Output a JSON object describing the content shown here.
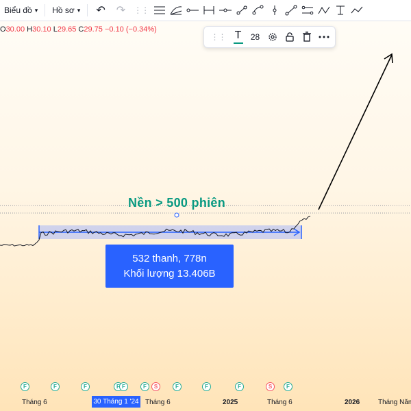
{
  "toolbar": {
    "chart_menu": "Biểu đồ",
    "profile_menu": "Hồ sơ",
    "undo": "↶",
    "redo": "↷",
    "tools": [
      "horizontal-lines-icon",
      "fib-fan-icon",
      "horizontal-ray-icon",
      "date-range-icon",
      "cross-line-icon",
      "trend-line-icon",
      "curve-icon",
      "vertical-line-icon",
      "trend-angle-icon",
      "parallel-channel-icon",
      "zigzag-icon",
      "text-cursor-icon",
      "path-icon"
    ]
  },
  "ohlc": {
    "o_label": "O",
    "o_value": "30.00",
    "h_label": "H",
    "h_value": "30.10",
    "l_label": "L",
    "l_value": "29.65",
    "c_label": "C",
    "c_value": "29.75",
    "change": "−0.10 (−0.34%)"
  },
  "drawing_toolbar": {
    "text_icon": "T",
    "font_size": "28"
  },
  "annotation": {
    "title": "Nền > 500 phiên",
    "bars": "532 thanh, 778n",
    "volume": "Khối lượng 13.406B"
  },
  "events": [
    "F",
    "F",
    "F",
    "F",
    "F",
    "F",
    "S",
    "F",
    "F",
    "F",
    "S",
    "F"
  ],
  "x_axis": {
    "labels": [
      "Tháng 6",
      "Tháng 6",
      "2025",
      "Tháng 6",
      "2026",
      "Tháng Năm"
    ],
    "crosshair": "30 Tháng 1 '24"
  },
  "colors": {
    "accent": "#2962ff",
    "title_green": "#089981",
    "range_fill": "#c8cdef",
    "up": "#22ab94",
    "down": "#f23645"
  }
}
